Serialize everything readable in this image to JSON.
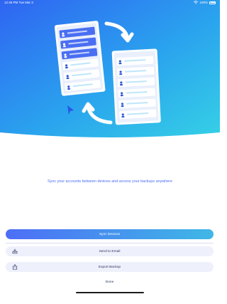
{
  "status_bar": {
    "time": "12:46 PM",
    "date": "Tue Mar 3",
    "battery": "100%"
  },
  "tagline": "Sync your accounts between devices and access your backups anywhere",
  "actions": {
    "sync": "Sync Devices",
    "email": "Send to Email",
    "export": "Export Backup",
    "done": "Done"
  },
  "icons": {
    "email": "inbox-tray-icon",
    "export": "share-upload-icon"
  },
  "colors": {
    "accent_start": "#4d6ef6",
    "accent_end": "#3fb7e6",
    "button_soft_bg": "#eef0fb",
    "text_dark": "#2d3564",
    "tagline": "#4a6df0"
  }
}
